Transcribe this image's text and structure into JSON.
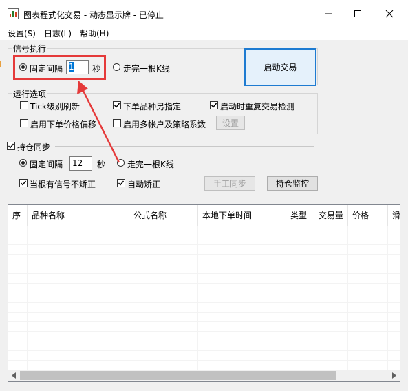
{
  "window": {
    "title": "图表程式化交易 - 动态显示牌 - 已停止",
    "controls": [
      "minimize",
      "maximize",
      "close"
    ]
  },
  "menu": [
    {
      "label": "设置(S)"
    },
    {
      "label": "日志(L)"
    },
    {
      "label": "帮助(H)"
    }
  ],
  "signal_exec": {
    "group_title": "信号执行",
    "fixed_interval_label": "固定间隔",
    "interval_value": "1",
    "seconds_label": "秒",
    "kline_label": "走完一根K线"
  },
  "start_button": "启动交易",
  "run_options": {
    "group_title": "运行选项",
    "tick_refresh": "Tick级别刷新",
    "order_product": "下单品种另指定",
    "repeat_check": "启动时重复交易检测",
    "price_offset": "启用下单价格偏移",
    "multi_account": "启用多帐户及策略系数",
    "settings_button": "设置"
  },
  "position_sync": {
    "group_title": "持仓同步",
    "fixed_interval_label": "固定间隔",
    "interval_value": "12",
    "seconds_label": "秒",
    "kline_label": "走完一根K线",
    "no_signal_label": "当根有信号不矫正",
    "auto_correct_label": "自动矫正",
    "manual_sync_button": "手工同步",
    "monitor_button": "持仓监控"
  },
  "table": {
    "columns": [
      "序",
      "品种名称",
      "公式名称",
      "本地下单时间",
      "类型",
      "交易量",
      "价格",
      "滑"
    ],
    "rows": []
  },
  "colors": {
    "accent": "#1e7bd1",
    "annotation": "#e53a3a",
    "background": "#f0f0f0"
  }
}
